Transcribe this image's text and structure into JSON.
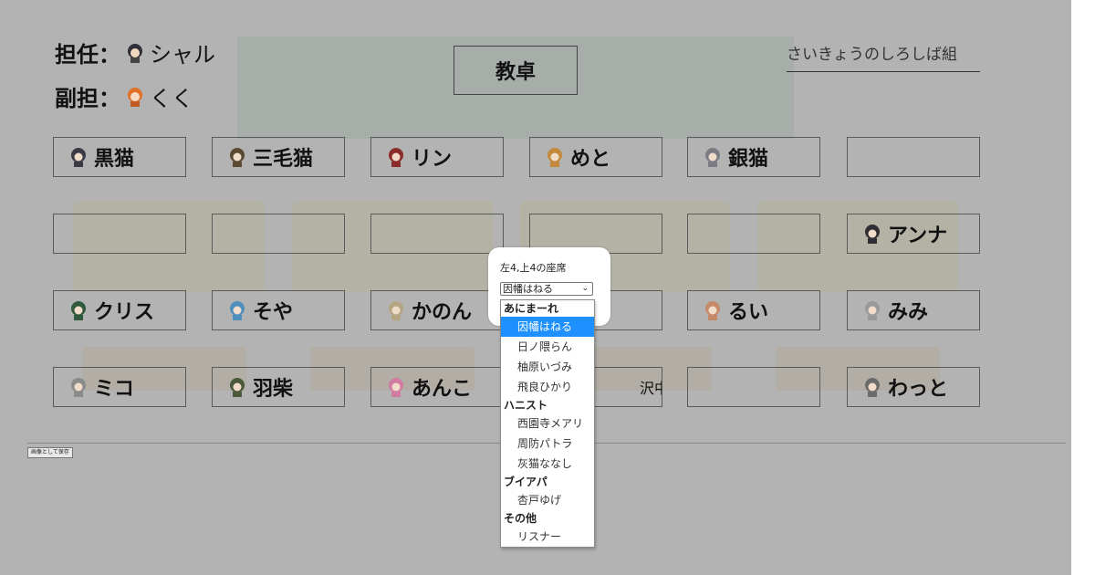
{
  "staff": {
    "homeroom": {
      "label": "担任：",
      "name": "シャル",
      "avatar_icon": "dark-hair-avatar-icon"
    },
    "assistant": {
      "label": "副担：",
      "name": "くく",
      "avatar_icon": "orange-hair-avatar-icon"
    }
  },
  "teacher_desk": "教卓",
  "class_name": "さいきょうのしろしば組",
  "seats": [
    [
      {
        "name": "黒猫",
        "avatar": "#3b3b46"
      },
      {
        "name": "三毛猫",
        "avatar": "#5a4a32"
      },
      {
        "name": "リン",
        "avatar": "#8a2c2a"
      },
      {
        "name": "めと",
        "avatar": "#c28a3a"
      },
      {
        "name": "銀猫",
        "avatar": "#7b7b84"
      },
      {
        "name": "",
        "avatar": ""
      }
    ],
    [
      {
        "name": "",
        "avatar": ""
      },
      {
        "name": "",
        "avatar": ""
      },
      {
        "name": "",
        "avatar": ""
      },
      {
        "name": "",
        "avatar": ""
      },
      {
        "name": "",
        "avatar": ""
      },
      {
        "name": "アンナ",
        "avatar": "#2e2e34"
      }
    ],
    [
      {
        "name": "クリス",
        "avatar": "#2f5a3b"
      },
      {
        "name": "そや",
        "avatar": "#4f8fbd"
      },
      {
        "name": "かのん",
        "avatar": "#b4a583"
      },
      {
        "name": "",
        "avatar": ""
      },
      {
        "name": "るい",
        "avatar": "#c58a6a"
      },
      {
        "name": "みみ",
        "avatar": "#9a9a9a"
      }
    ],
    [
      {
        "name": "ミコ",
        "avatar": "#8b8b8b"
      },
      {
        "name": "羽柴",
        "avatar": "#4a5a3a"
      },
      {
        "name": "あんこ",
        "avatar": "#d17ba0"
      },
      {
        "name": "沢中",
        "avatar": ""
      },
      {
        "name": "",
        "avatar": ""
      },
      {
        "name": "わっと",
        "avatar": "#6b6b6b"
      }
    ]
  ],
  "save_button": "画像として保存",
  "popup": {
    "title": "左4,上4の座席",
    "selected": "因幡はねる",
    "chevron_icon": "chevron-down-icon"
  },
  "dropdown": {
    "groups": [
      {
        "label": "あにまーれ",
        "options": [
          "因幡はねる",
          "日ノ隈らん",
          "柚原いづみ",
          "飛良ひかり"
        ]
      },
      {
        "label": "ハニスト",
        "options": [
          "西園寺メアリ",
          "周防パトラ",
          "灰猫ななし"
        ]
      },
      {
        "label": "ブイアパ",
        "options": [
          "杏戸ゆげ"
        ]
      },
      {
        "label": "その他",
        "options": [
          "リスナー"
        ]
      }
    ],
    "highlighted": "因幡はねる"
  },
  "colors": {
    "overlay": "#b3b3b3",
    "highlight": "#1e90ff"
  }
}
